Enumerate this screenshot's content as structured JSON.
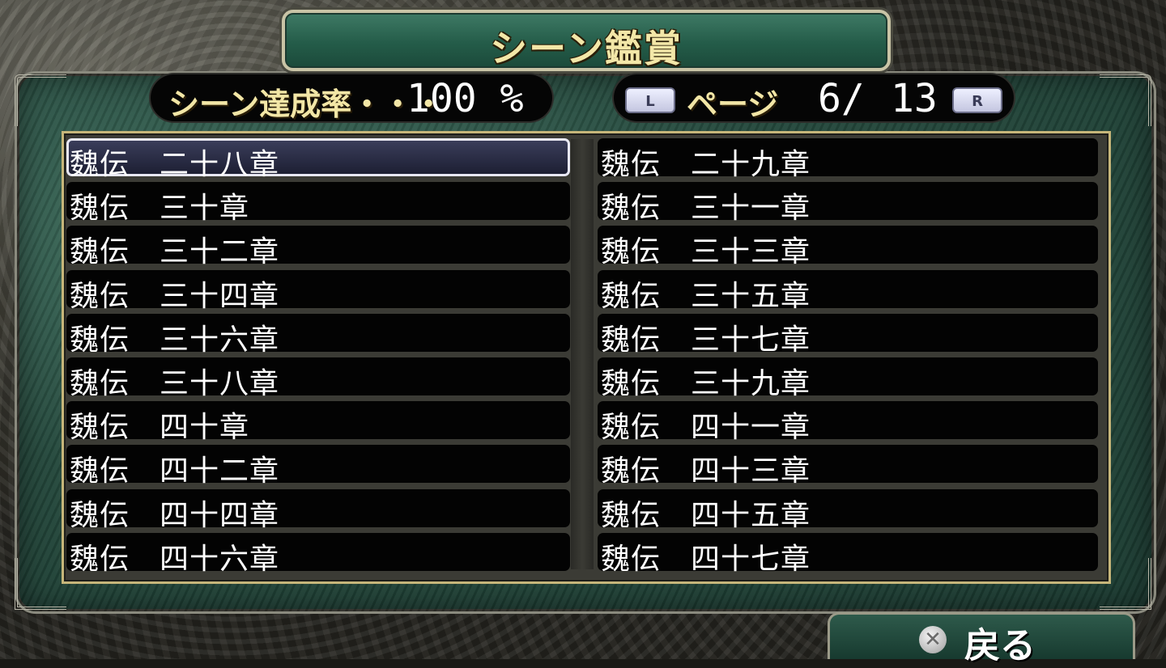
{
  "title": "シーン鑑賞",
  "completion": {
    "label": "シーン達成率・・・",
    "value": "100 %"
  },
  "pager": {
    "left_key": "L",
    "label": "ページ",
    "current": "6/",
    "total": "13",
    "right_key": "R"
  },
  "scenes": {
    "left": [
      "魏伝　二十八章",
      "魏伝　三十章",
      "魏伝　三十二章",
      "魏伝　三十四章",
      "魏伝　三十六章",
      "魏伝　三十八章",
      "魏伝　四十章",
      "魏伝　四十二章",
      "魏伝　四十四章",
      "魏伝　四十六章"
    ],
    "right": [
      "魏伝　二十九章",
      "魏伝　三十一章",
      "魏伝　三十三章",
      "魏伝　三十五章",
      "魏伝　三十七章",
      "魏伝　三十九章",
      "魏伝　四十一章",
      "魏伝　四十三章",
      "魏伝　四十五章",
      "魏伝　四十七章"
    ],
    "selected": "魏伝　二十八章"
  },
  "back": {
    "icon": "cross-button-icon",
    "label": "戻る"
  },
  "colors": {
    "panel_green": "#24483c",
    "title_gold": "#f3e7a8",
    "list_border": "#c6b67a"
  }
}
